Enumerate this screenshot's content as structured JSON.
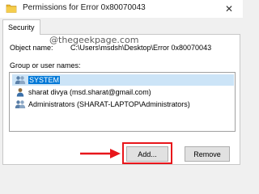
{
  "window": {
    "title": "Permissions for Error 0x80070043",
    "close_glyph": "✕"
  },
  "tabs": [
    {
      "label": "Security"
    }
  ],
  "security": {
    "object_name_label": "Object name:",
    "object_name_value": "C:\\Users\\msdsh\\Desktop\\Error 0x80070043",
    "group_label": "Group or user names:",
    "users": [
      {
        "label": "SYSTEM",
        "icon": "user-group-icon",
        "selected": true
      },
      {
        "label": "sharat divya (msd.sharat@gmail.com)",
        "icon": "user-icon",
        "selected": false
      },
      {
        "label": "Administrators (SHARAT-LAPTOP\\Administrators)",
        "icon": "user-group-icon",
        "selected": false
      }
    ],
    "add_label": "Add...",
    "remove_label": "Remove"
  },
  "watermark": "@thegeekpage.com",
  "annotation": {
    "highlight_color": "#e8161b",
    "arrow_color": "#e8161b"
  }
}
